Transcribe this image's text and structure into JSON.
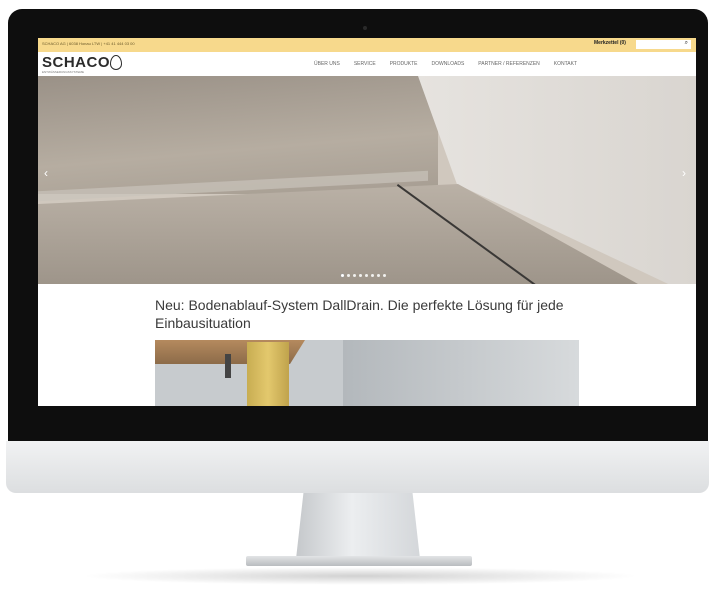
{
  "topbar": {
    "address": "SCHACO AG | 6038 Honau LTW | +41 41 444 03 00",
    "shop_label": "Merkzettel (0)",
    "search_placeholder": "",
    "search_icon": "search-icon"
  },
  "header": {
    "logo_text": "SCHACO",
    "tagline": "ENTWÄSSERUNGSSYSTEME",
    "nav": [
      "ÜBER UNS",
      "SERVICE",
      "PRODUKTE",
      "DOWNLOADS",
      "PARTNER / REFERENZEN",
      "KONTAKT"
    ]
  },
  "slider": {
    "prev_icon": "chevron-left-icon",
    "next_icon": "chevron-right-icon",
    "prev_glyph": "‹",
    "next_glyph": "›",
    "dot_count": 8,
    "active_dot": 0
  },
  "main": {
    "headline": "Neu: Bodenablauf-System DallDrain. Die perfekte Lösung für jede Einbausituation"
  },
  "colors": {
    "topbar": "#f7d98c",
    "bezel": "#0e0e0e",
    "headline": "#3a3a3a"
  }
}
